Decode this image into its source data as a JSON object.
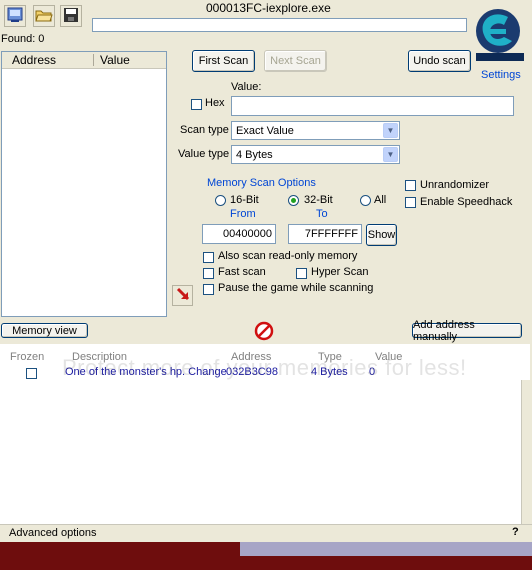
{
  "window": {
    "process_title": "000013FC-iexplore.exe",
    "found_label": "Found: 0",
    "settings_label": "Settings"
  },
  "toolbar": {
    "icons": [
      "process-select-icon",
      "open-folder-icon",
      "save-disk-icon"
    ]
  },
  "results_list": {
    "col_address": "Address",
    "col_value": "Value"
  },
  "scan": {
    "first_scan": "First Scan",
    "next_scan": "Next Scan",
    "undo_scan": "Undo scan",
    "value_label": "Value:",
    "hex_label": "Hex",
    "value_input": "",
    "scan_type_label": "Scan type",
    "scan_type_value": "Exact Value",
    "value_type_label": "Value type",
    "value_type_value": "4 Bytes"
  },
  "memory_options": {
    "title": "Memory Scan Options",
    "bit16": "16-Bit",
    "bit32": "32-Bit",
    "all": "All",
    "from_label": "From",
    "to_label": "To",
    "from_value": "00400000",
    "to_value": "7FFFFFFF",
    "show_button": "Show",
    "readonly": "Also scan read-only memory",
    "fast_scan": "Fast scan",
    "hyper_scan": "Hyper Scan",
    "pause": "Pause the game while scanning"
  },
  "right_options": {
    "unrandomizer": "Unrandomizer",
    "speedhack": "Enable Speedhack"
  },
  "bottom_bar": {
    "memory_view": "Memory view",
    "add_address": "Add address manually"
  },
  "cheat_table": {
    "headers": {
      "frozen": "Frozen",
      "description": "Description",
      "address": "Address",
      "type": "Type",
      "value": "Value"
    },
    "rows": [
      {
        "description": "One of the monster's hp. Change",
        "address": "032B3C98",
        "type": "4 Bytes",
        "value": "0"
      }
    ]
  },
  "footer": {
    "advanced": "Advanced options",
    "help": "?"
  },
  "watermark": "Protect more of your memories for less!",
  "colors": {
    "window_bg": "#ece9d8",
    "accent_blue": "#0046d5",
    "red_bar": "#6e0d0d"
  }
}
